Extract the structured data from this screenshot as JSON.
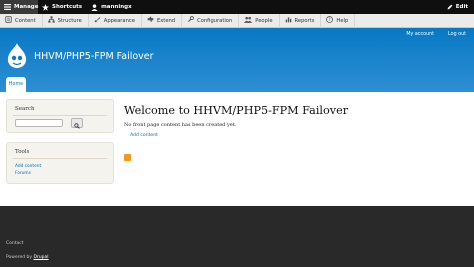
{
  "toolbar": {
    "manage": "Manage",
    "shortcuts": "Shortcuts",
    "user": "manningx",
    "edit": "Edit"
  },
  "tray": {
    "items": [
      {
        "label": "Content",
        "icon": "content-icon"
      },
      {
        "label": "Structure",
        "icon": "structure-icon"
      },
      {
        "label": "Appearance",
        "icon": "appearance-icon"
      },
      {
        "label": "Extend",
        "icon": "extend-icon"
      },
      {
        "label": "Configuration",
        "icon": "configuration-icon"
      },
      {
        "label": "People",
        "icon": "people-icon"
      },
      {
        "label": "Reports",
        "icon": "reports-icon"
      },
      {
        "label": "Help",
        "icon": "help-icon"
      }
    ]
  },
  "header": {
    "secondary_menu": [
      "My account",
      "Log out"
    ],
    "site_name": "HHVM/PHP5-FPM Failover",
    "tab_home": "Home"
  },
  "sidebar": {
    "search_title": "Search",
    "tools_title": "Tools",
    "tools_links": [
      "Add content",
      "Forums"
    ]
  },
  "main": {
    "title": "Welcome to HHVM/PHP5-FPM Failover",
    "no_content": "No front page content has been created yet.",
    "add_content": "Add content"
  },
  "footer": {
    "contact": "Contact",
    "powered_prefix": "Powered by ",
    "powered_link": "Drupal"
  },
  "colors": {
    "header_blue": "#0778c4",
    "link": "#0071b3",
    "footer": "#292929"
  }
}
